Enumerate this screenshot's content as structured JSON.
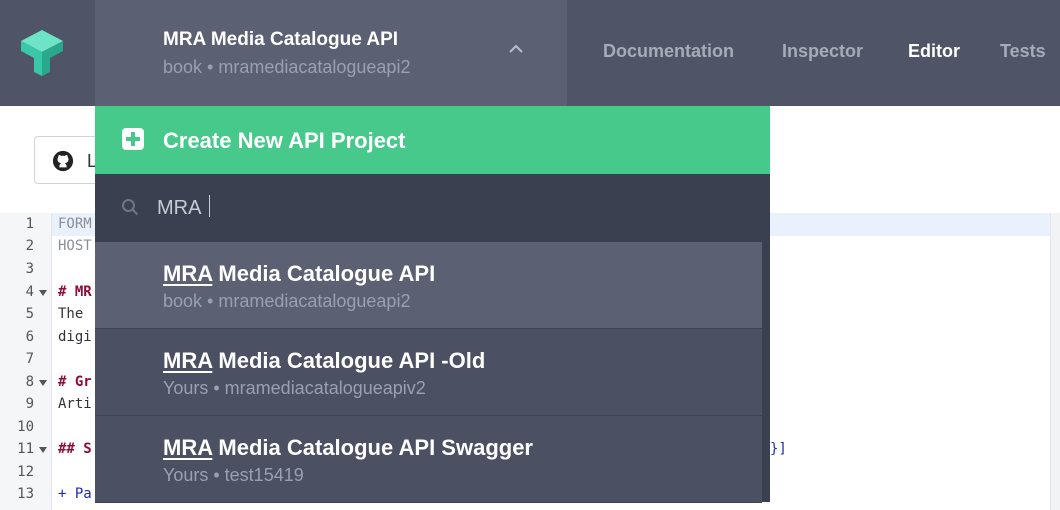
{
  "header": {
    "project": {
      "title": "MRA Media Catalogue API",
      "subtitle": "book • mramediacatalogueapi2"
    },
    "nav": [
      "Documentation",
      "Inspector",
      "Editor",
      "Tests"
    ],
    "active_nav": "Editor"
  },
  "github_button": {
    "label": "L"
  },
  "editor": {
    "line_numbers": [
      "1",
      "2",
      "3",
      "4",
      "5",
      "6",
      "7",
      "8",
      "9",
      "10",
      "11",
      "12",
      "13"
    ],
    "lines": [
      "FORM",
      "HOST",
      "",
      "# MR",
      "The ",
      "digi",
      "",
      "# Gr",
      "Arti",
      "",
      "## S",
      "",
      "+ Pa"
    ],
    "trailing_brace": "}]"
  },
  "dropdown": {
    "create_label": "Create New API Project",
    "search": {
      "value": "MRA",
      "placeholder": ""
    },
    "results": [
      {
        "match": "MRA",
        "rest": " Media Catalogue API",
        "subtitle": "book • mramediacatalogueapi2"
      },
      {
        "match": "MRA",
        "rest": " Media Catalogue API -Old",
        "subtitle": "Yours • mramediacatalogueapiv2"
      },
      {
        "match": "MRA",
        "rest": " Media Catalogue API Swagger",
        "subtitle": "Yours • test15419"
      }
    ]
  },
  "colors": {
    "topbar": "#4f5566",
    "switcher": "#5b6173",
    "create_green": "#47c98b",
    "search_bg": "#3b4050",
    "dropdown_bg": "#4b5062"
  }
}
